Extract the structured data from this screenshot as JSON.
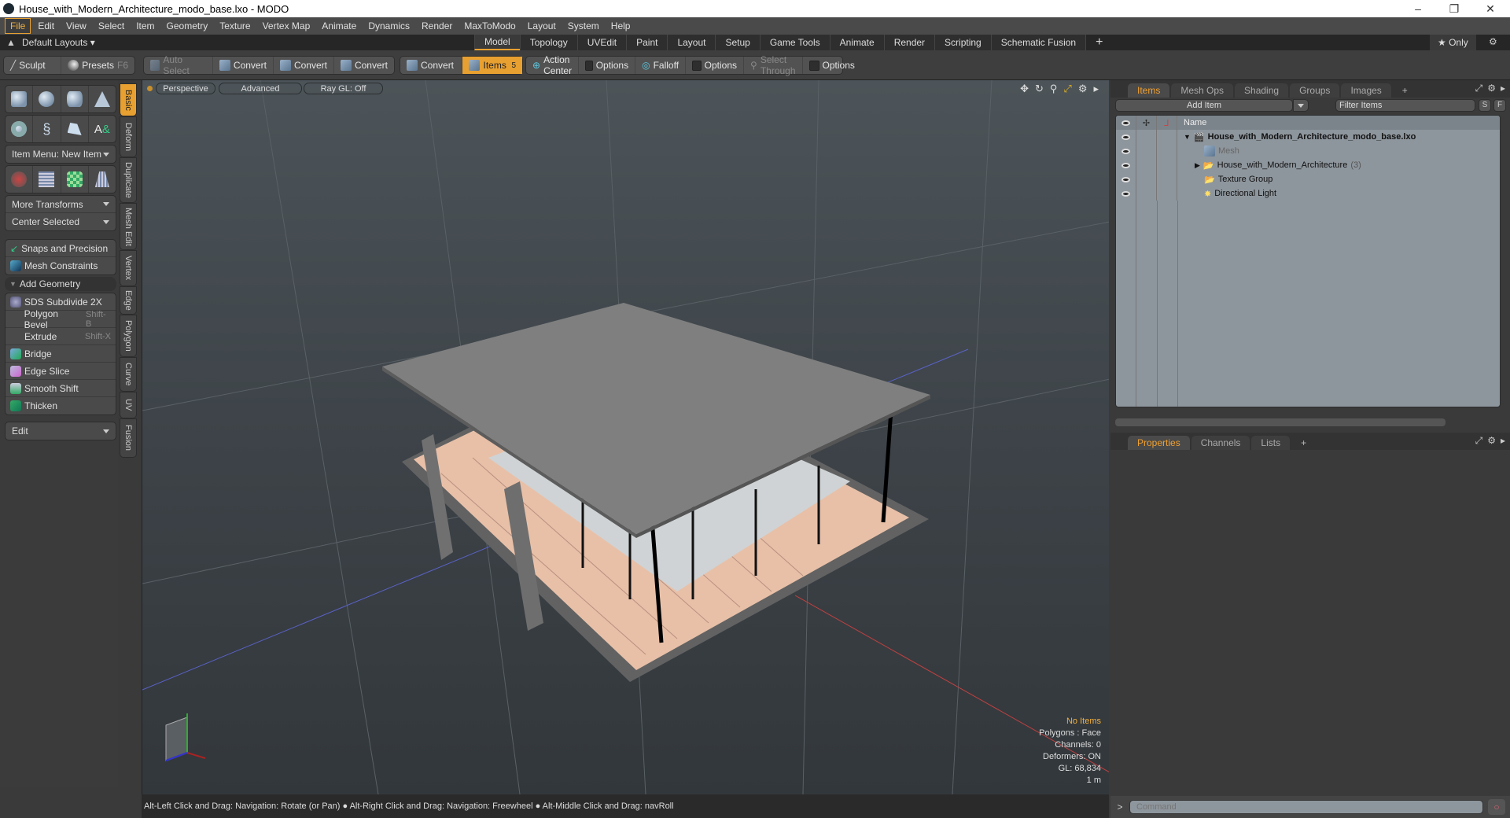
{
  "window": {
    "title": "House_with_Modern_Architecture_modo_base.lxo - MODO",
    "min": "–",
    "max": "❐",
    "close": "✕"
  },
  "menu": [
    "File",
    "Edit",
    "View",
    "Select",
    "Item",
    "Geometry",
    "Texture",
    "Vertex Map",
    "Animate",
    "Dynamics",
    "Render",
    "MaxToModo",
    "Layout",
    "System",
    "Help"
  ],
  "layouts": {
    "label": "Default Layouts ▾",
    "tabs": [
      "Model",
      "Topology",
      "UVEdit",
      "Paint",
      "Layout",
      "Setup",
      "Game Tools",
      "Animate",
      "Render",
      "Scripting",
      "Schematic Fusion"
    ],
    "active": "Model",
    "plus": "+",
    "only": "★ Only",
    "gear": "⚙"
  },
  "toolbar": {
    "sculpt": "Sculpt",
    "presets": "Presets",
    "presets_key": "F6",
    "auto_select": "Auto Select",
    "convert1": "Convert",
    "convert2": "Convert",
    "convert3": "Convert",
    "convert4": "Convert",
    "items": "Items",
    "items_count": "5",
    "action_center": "Action Center",
    "options1": "Options",
    "falloff": "Falloff",
    "options2": "Options",
    "select_through": "Select Through",
    "options3": "Options"
  },
  "left": {
    "tabs": [
      "Basic",
      "Deform",
      "Duplicate",
      "Mesh Edit",
      "Vertex",
      "Edge",
      "Polygon",
      "Curve",
      "UV",
      "Fusion"
    ],
    "item_menu": "Item Menu: New Item",
    "more_transforms": "More Transforms",
    "center_selected": "Center Selected",
    "snaps": "Snaps and Precision",
    "mesh_constraints": "Mesh Constraints",
    "add_geometry": "Add Geometry",
    "tools": [
      {
        "label": "SDS Subdivide 2X",
        "shortcut": ""
      },
      {
        "label": "Polygon Bevel",
        "shortcut": "Shift-B"
      },
      {
        "label": "Extrude",
        "shortcut": "Shift-X"
      },
      {
        "label": "Bridge",
        "shortcut": ""
      },
      {
        "label": "Edge Slice",
        "shortcut": ""
      },
      {
        "label": "Smooth Shift",
        "shortcut": ""
      },
      {
        "label": "Thicken",
        "shortcut": ""
      }
    ],
    "edit": "Edit"
  },
  "viewport": {
    "perspective": "Perspective",
    "advanced": "Advanced",
    "raygl": "Ray GL: Off",
    "stats": {
      "items": "No Items",
      "polygons": "Polygons : Face",
      "channels": "Channels: 0",
      "deformers": "Deformers: ON",
      "gl": "GL: 68,834",
      "unit": "1 m"
    }
  },
  "status": "Alt-Left Click and Drag: Navigation: Rotate (or Pan) ● Alt-Right Click and Drag: Navigation: Freewheel ● Alt-Middle Click and Drag: navRoll",
  "items_panel": {
    "tabs": [
      "Items",
      "Mesh Ops",
      "Shading",
      "Groups",
      "Images"
    ],
    "add_item": "Add Item",
    "filter": "Filter Items",
    "s": "S",
    "f": "F",
    "name_col": "Name",
    "rows": [
      {
        "name": "House_with_Modern_Architecture_modo_base.lxo",
        "count": ""
      },
      {
        "name": "Mesh",
        "count": ""
      },
      {
        "name": "House_with_Modern_Architecture",
        "count": "(3)"
      },
      {
        "name": "Texture Group",
        "count": ""
      },
      {
        "name": "Directional Light",
        "count": ""
      }
    ]
  },
  "props_panel": {
    "tabs": [
      "Properties",
      "Channels",
      "Lists"
    ]
  },
  "command": {
    "prompt": ">",
    "placeholder": "Command"
  }
}
